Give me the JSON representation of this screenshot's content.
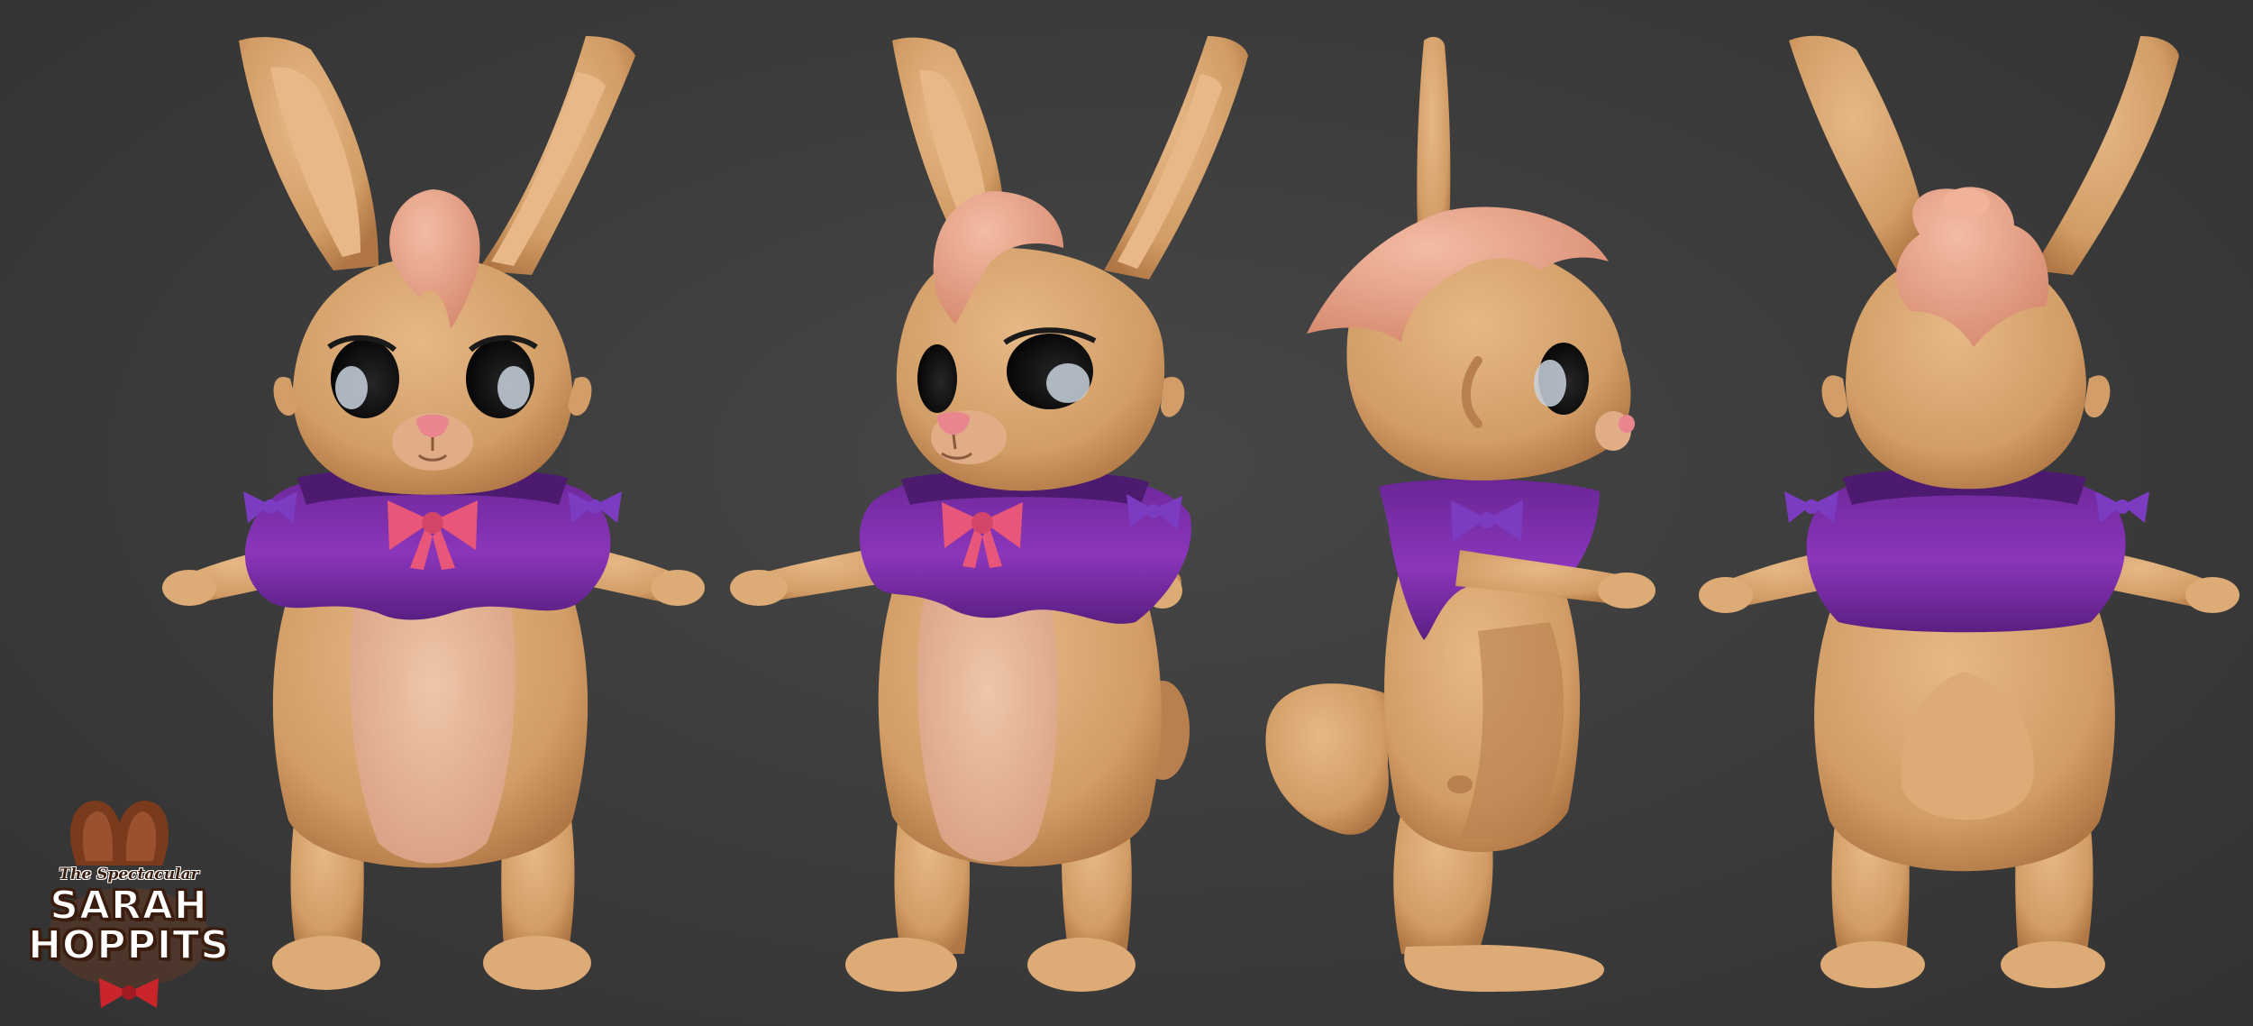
{
  "logo": {
    "subtitle": "The Spectacular",
    "line1": "SARAH",
    "line2": "HOPPITS"
  },
  "views": [
    {
      "name": "front"
    },
    {
      "name": "three-quarter"
    },
    {
      "name": "side"
    },
    {
      "name": "back"
    }
  ],
  "colors": {
    "background": "#3b3b3b",
    "fur": "#d9a66f",
    "fur_shadow": "#b8804e",
    "belly": "#e6b596",
    "ear_inner": "#e9b889",
    "hair": "#e9a58a",
    "cape": "#7a2ea8",
    "cape_dark": "#4c1a6e",
    "bow_pink": "#e8577a",
    "bow_purple": "#7b3cc2",
    "nose": "#e9858f",
    "eye": "#121212",
    "eye_white": "#c9d2dd",
    "logo_brown": "#7a3b1c",
    "logo_bow": "#c9252b"
  }
}
